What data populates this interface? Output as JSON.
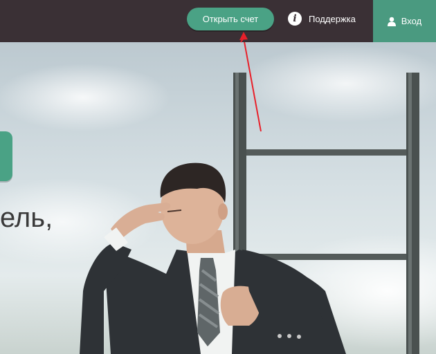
{
  "header": {
    "open_account_label": "Открыть счет",
    "support_label": "Поддержка",
    "login_label": "Вход"
  },
  "hero": {
    "headline_fragment": "ель,"
  },
  "colors": {
    "topbar": "#3a3035",
    "accent": "#4aa285",
    "login_bg": "#4a9a80",
    "annotation_arrow": "#e8202a"
  },
  "icons": {
    "support": "info-icon",
    "login": "user-icon"
  }
}
